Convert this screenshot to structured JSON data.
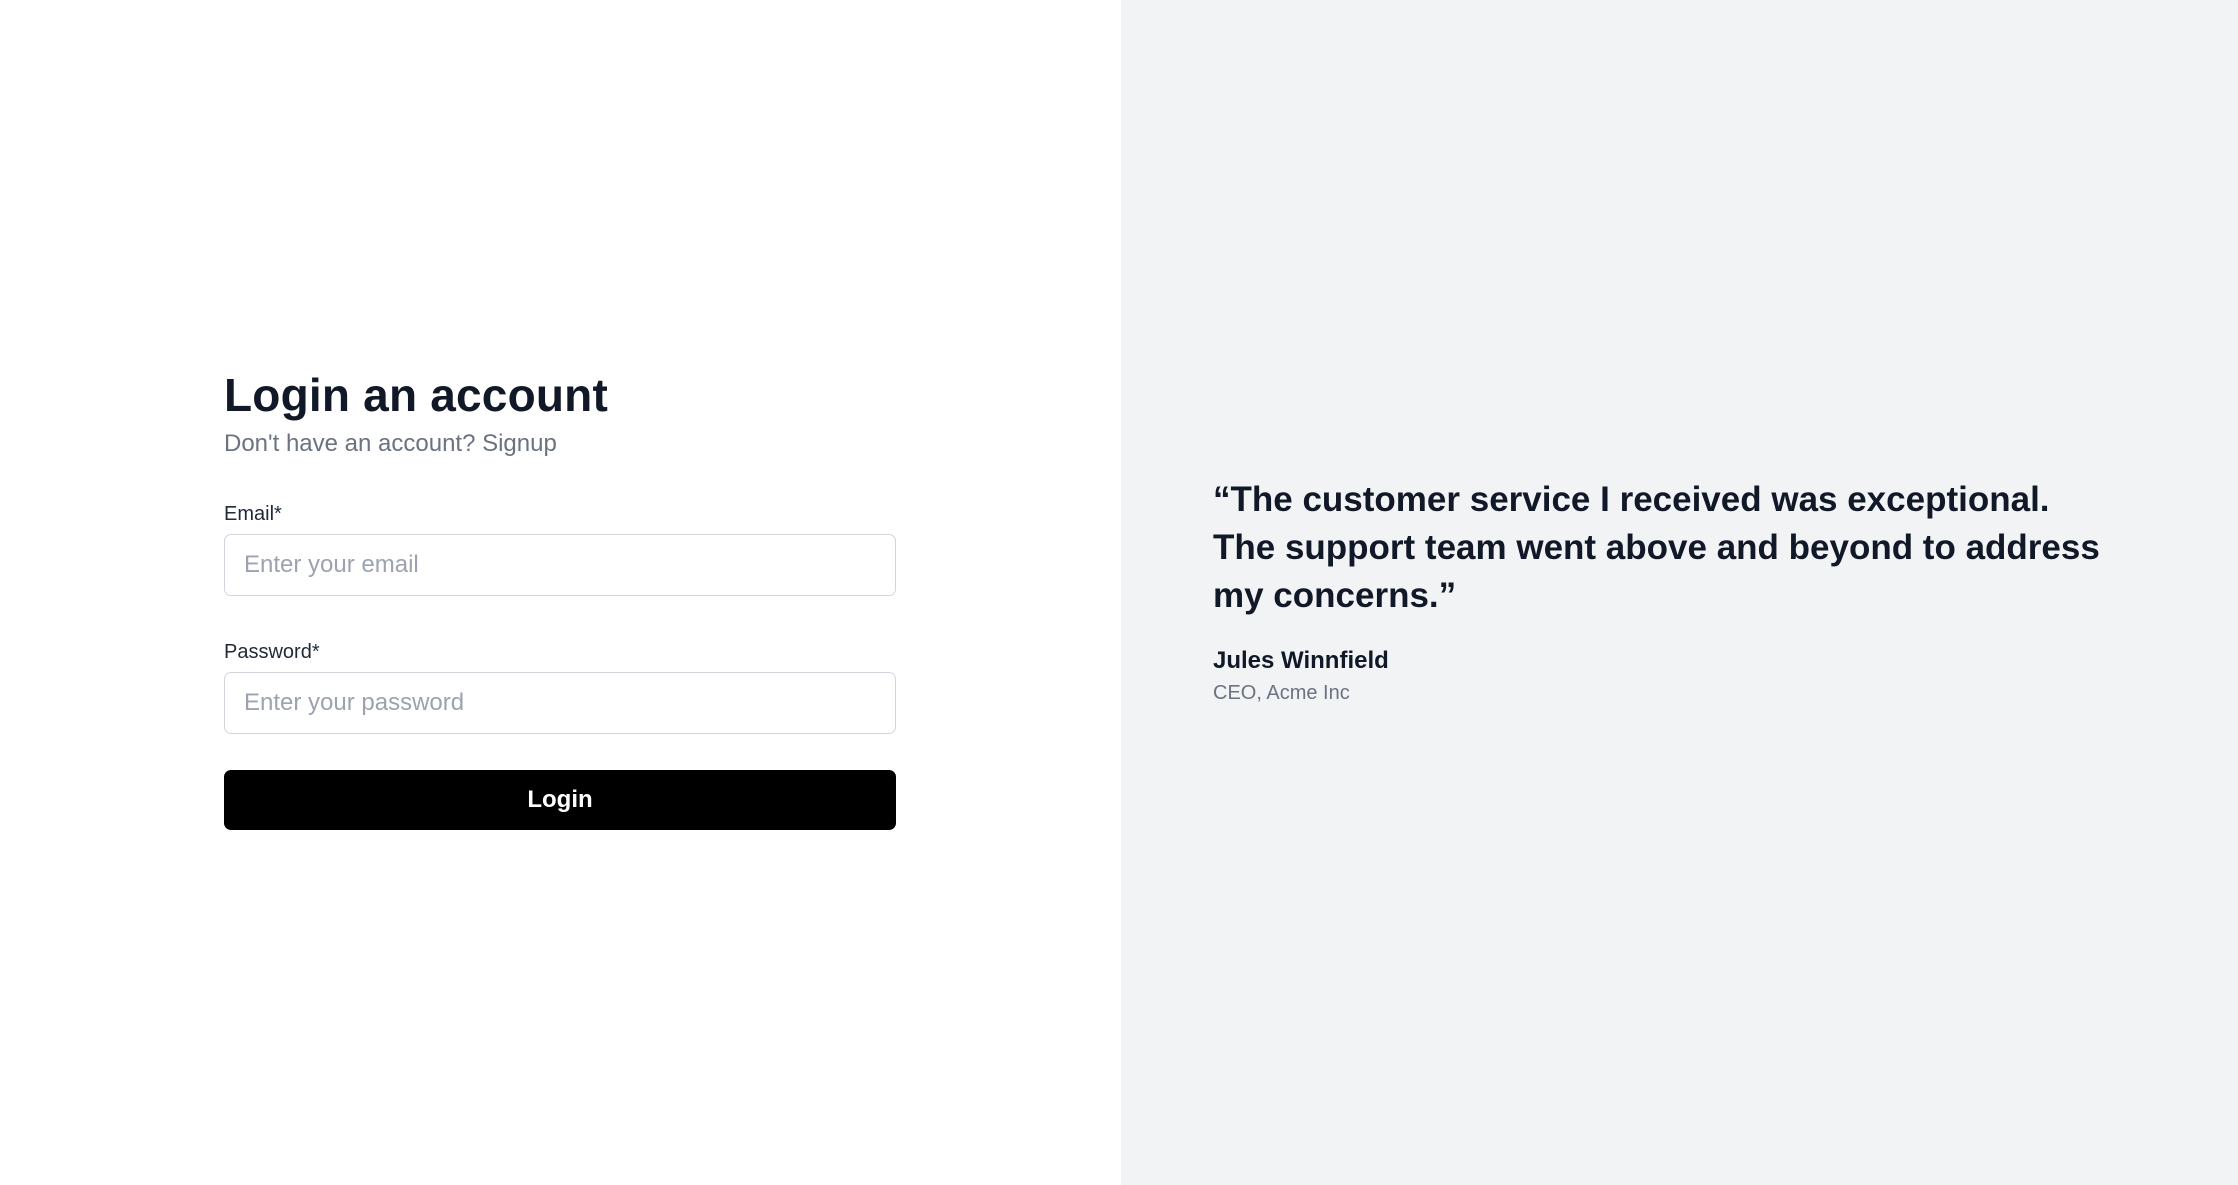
{
  "login": {
    "title": "Login an account",
    "subtitle_prefix": "Don't have an account? ",
    "signup_link": "Signup",
    "email": {
      "label": "Email*",
      "placeholder": "Enter your email",
      "value": ""
    },
    "password": {
      "label": "Password*",
      "placeholder": "Enter your password",
      "value": ""
    },
    "submit_label": "Login"
  },
  "testimonial": {
    "quote": "“The customer service I received was exceptional. The support team went above and beyond to address my concerns.”",
    "author_name": "Jules Winnfield",
    "author_role": "CEO, Acme Inc"
  },
  "colors": {
    "left_background": "#ffffff",
    "right_background": "#f2f3f5",
    "button_background": "#000000",
    "heading_text": "#111827",
    "muted_text": "#6b7280"
  }
}
